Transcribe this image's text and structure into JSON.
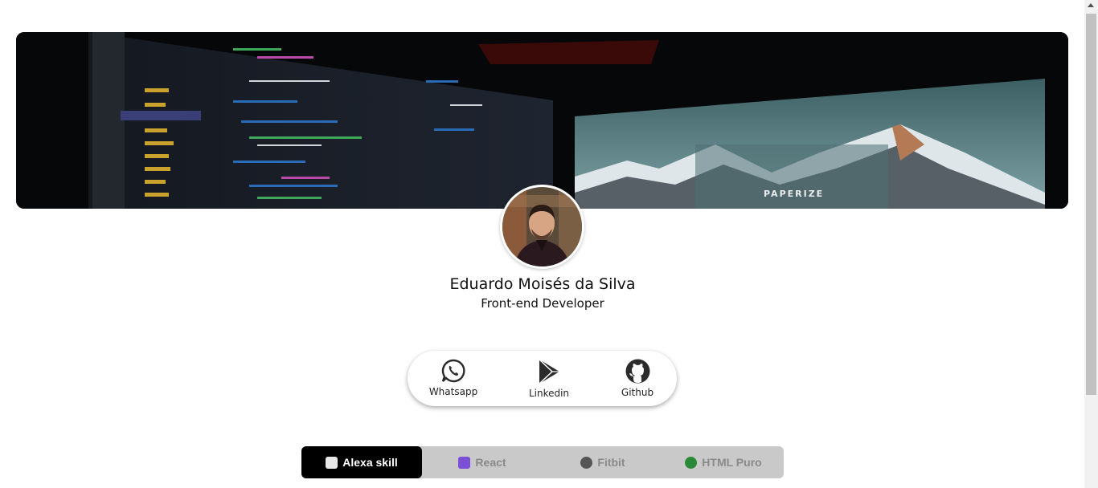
{
  "profile": {
    "name": "Eduardo Moisés da Silva",
    "role": "Front-end Developer"
  },
  "banner": {
    "screen_text": "PAPERIZE"
  },
  "social": {
    "items": [
      {
        "label": "Whatsapp",
        "icon": "whatsapp-icon"
      },
      {
        "label": "Linkedin",
        "icon": "play-store-icon"
      },
      {
        "label": "Github",
        "icon": "github-icon"
      }
    ]
  },
  "tabs": [
    {
      "label": "Alexa skill",
      "icon": "robot-icon",
      "active": true
    },
    {
      "label": "React",
      "icon": "atom-icon",
      "active": false
    },
    {
      "label": "Fitbit",
      "icon": "watch-icon",
      "active": false
    },
    {
      "label": "HTML Puro",
      "icon": "globe-icon",
      "active": false
    }
  ],
  "colors": {
    "active_tab": "#000000",
    "tab_bar": "#c9c9c9",
    "inactive_tab_text": "#8a8a8a"
  }
}
